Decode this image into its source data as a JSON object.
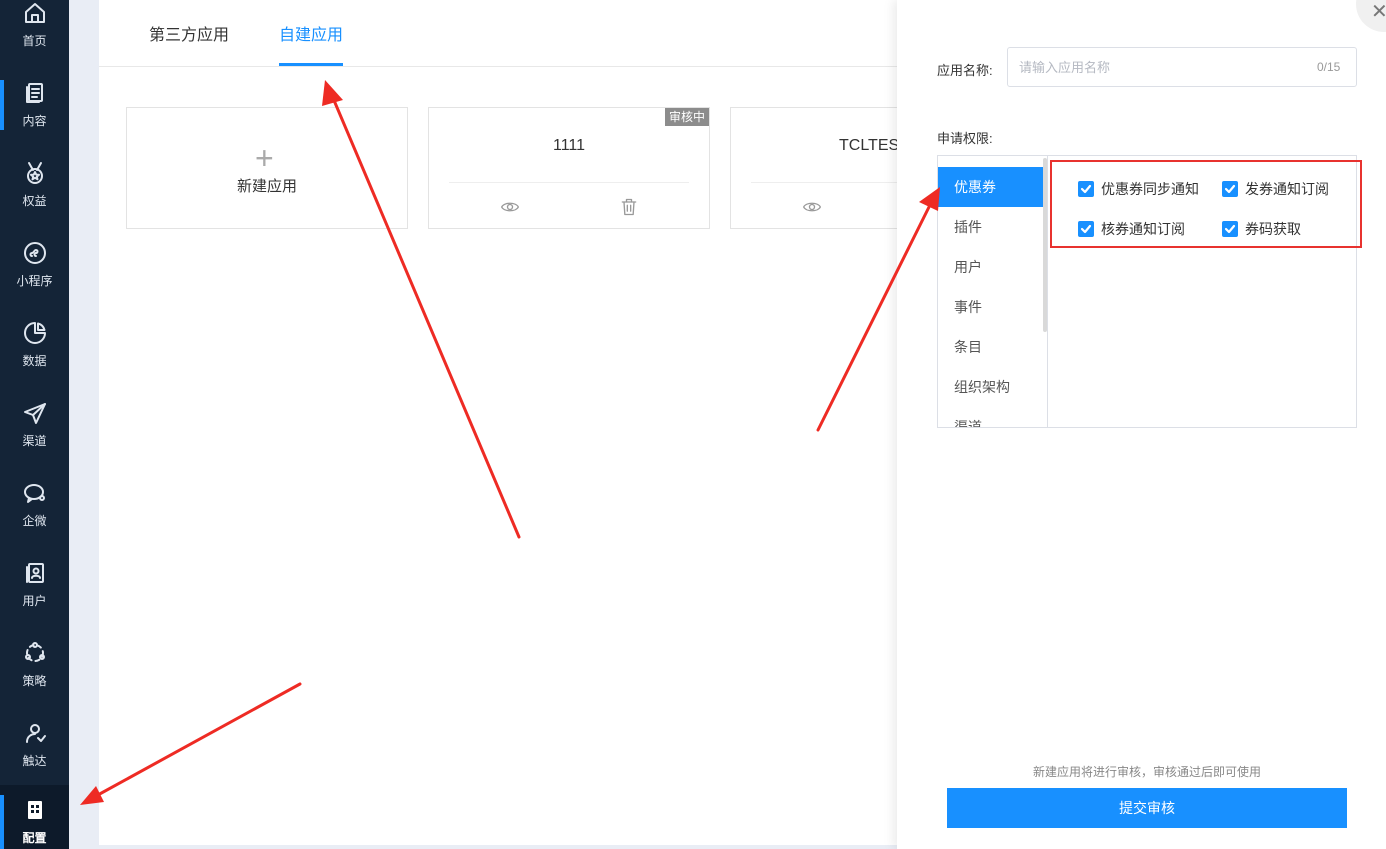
{
  "sidebar": {
    "items": [
      {
        "label": "首页",
        "icon": "home-icon"
      },
      {
        "label": "内容",
        "icon": "document-icon"
      },
      {
        "label": "权益",
        "icon": "medal-icon"
      },
      {
        "label": "小程序",
        "icon": "mini-program-icon"
      },
      {
        "label": "数据",
        "icon": "pie-chart-icon"
      },
      {
        "label": "渠道",
        "icon": "paper-plane-icon"
      },
      {
        "label": "企微",
        "icon": "wecom-icon"
      },
      {
        "label": "用户",
        "icon": "user-card-icon"
      },
      {
        "label": "策略",
        "icon": "strategy-icon"
      },
      {
        "label": "触达",
        "icon": "reach-icon"
      },
      {
        "label": "配置",
        "icon": "config-icon"
      }
    ],
    "active": "配置",
    "accent": "#1890ff"
  },
  "tabs": [
    {
      "label": "第三方应用"
    },
    {
      "label": "自建应用"
    }
  ],
  "cards": {
    "new_label": "新建应用",
    "apps": [
      {
        "name": "1111",
        "badge": "审核中"
      },
      {
        "name": "TCLTEST"
      }
    ]
  },
  "drawer": {
    "name_label": "应用名称:",
    "name_placeholder": "请输入应用名称",
    "name_value": "",
    "counter": "0/15",
    "perm_label": "申请权限:",
    "categories": [
      {
        "label": "优惠券"
      },
      {
        "label": "插件"
      },
      {
        "label": "用户"
      },
      {
        "label": "事件"
      },
      {
        "label": "条目"
      },
      {
        "label": "组织架构"
      },
      {
        "label": "渠道"
      }
    ],
    "permissions": [
      {
        "label": "优惠券同步通知",
        "checked": true
      },
      {
        "label": "发券通知订阅",
        "checked": true
      },
      {
        "label": "核券通知订阅",
        "checked": true
      },
      {
        "label": "券码获取",
        "checked": true
      }
    ],
    "note": "新建应用将进行审核，审核通过后即可使用",
    "submit_label": "提交审核"
  }
}
